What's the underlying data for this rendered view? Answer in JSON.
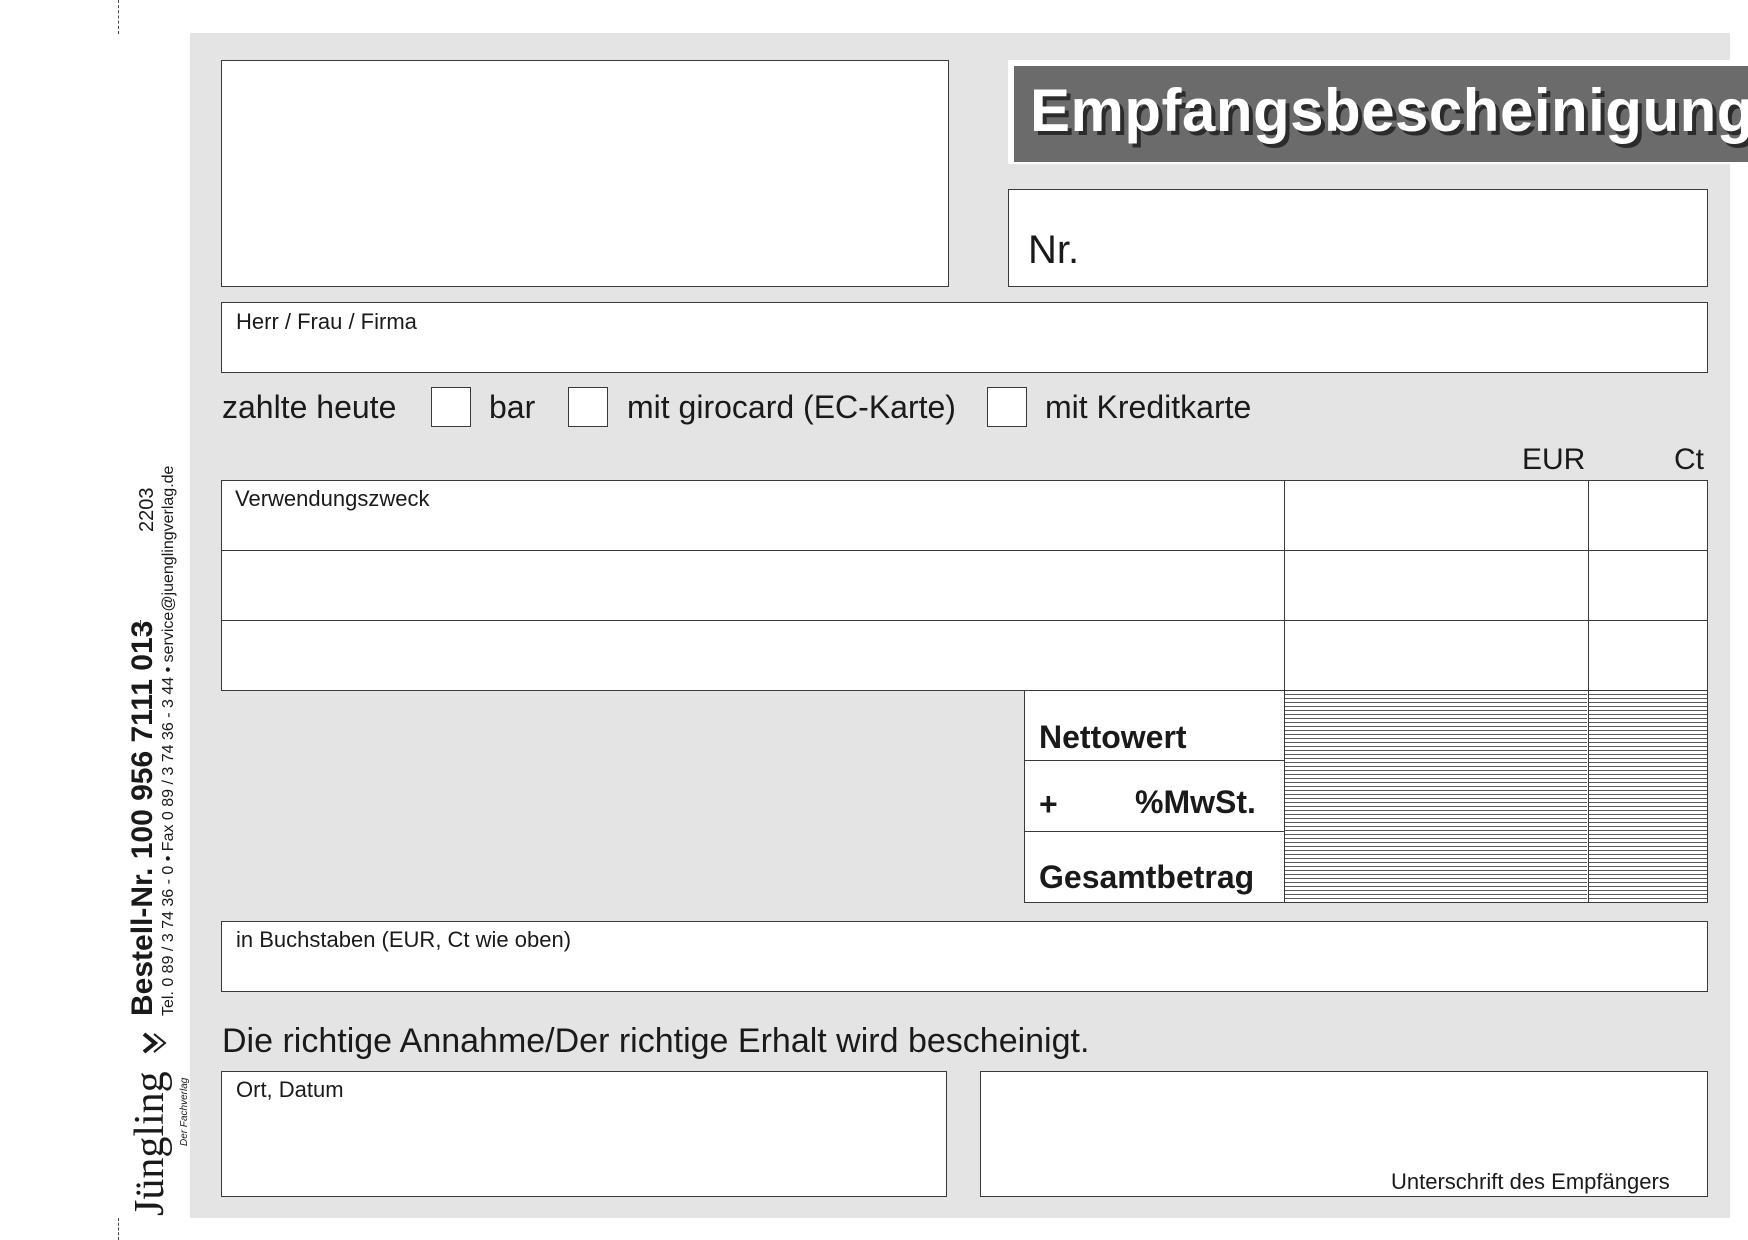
{
  "title": "Empfangsbescheinigung",
  "nr_label": "Nr.",
  "payer_label": "Herr / Frau / Firma",
  "payment": {
    "intro": "zahlte heute",
    "options": [
      "bar",
      "mit girocard (EC-Karte)",
      "mit Kreditkarte"
    ]
  },
  "columns": {
    "eur": "EUR",
    "ct": "Ct"
  },
  "purpose_label": "Verwendungszweck",
  "totals": {
    "net": "Nettowert",
    "vat_plus": "+",
    "vat": "%MwSt.",
    "gross": "Gesamtbetrag"
  },
  "in_words_label": "in Buchstaben (EUR, Ct wie oben)",
  "confirmation": "Die richtige Annahme/Der richtige Erhalt wird bescheinigt.",
  "place_date_label": "Ort, Datum",
  "signature_label": "Unterschrift des Empfängers",
  "sidebar": {
    "order_no": "Bestell-Nr. 100 956 7111 013",
    "contact": "Tel. 0 89 / 3 74 36 - 0 • Fax 0 89 / 3 74 36 - 3 44 • service@juenglingverlag.de",
    "form_no": "2203",
    "brand": "Jüngling",
    "brand_sub": "Der Fachverlag"
  }
}
